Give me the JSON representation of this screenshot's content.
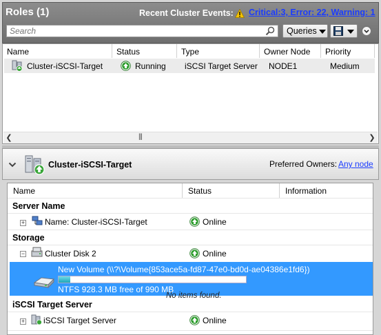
{
  "roles_pane": {
    "title": "Roles (1)",
    "events_label": "Recent Cluster Events:",
    "events_summary": "Critical:3, Error: 22, Warning: 1",
    "search_placeholder": "Search",
    "queries_label": "Queries",
    "columns": [
      "Name",
      "Status",
      "Type",
      "Owner Node",
      "Priority"
    ],
    "rows": [
      {
        "name": "Cluster-iSCSI-Target",
        "status": "Running",
        "type": "iSCSI Target Server",
        "owner_node": "NODE1",
        "priority": "Medium"
      }
    ]
  },
  "details_pane": {
    "title": "Cluster-iSCSI-Target",
    "preferred_owners_label": "Preferred Owners:",
    "preferred_owners_link": "Any node",
    "columns": [
      "Name",
      "Status",
      "Information"
    ],
    "groups": {
      "server_name": "Server Name",
      "storage": "Storage",
      "iscsi_target_server": "iSCSI Target Server"
    },
    "items": {
      "server_name_item": {
        "name": "Name: Cluster-iSCSI-Target",
        "status": "Online"
      },
      "cluster_disk": {
        "name": "Cluster Disk 2",
        "status": "Online"
      },
      "iscsi_item": {
        "name": "iSCSI Target Server",
        "status": "Online"
      }
    },
    "volume": {
      "name": "New Volume (\\\\?\\Volume{853ace5a-fd87-47e0-bd0d-ae04386e1fd6})",
      "free_text": "NTFS 928.3 MB free of 990 MB",
      "used_fraction": 0.0624
    },
    "no_items_text": "No items found."
  },
  "colors": {
    "header_gray": "#7a7a7a",
    "link_blue": "#1a3cff",
    "selection_blue": "#3399ff",
    "status_green": "#2e9e2e"
  }
}
